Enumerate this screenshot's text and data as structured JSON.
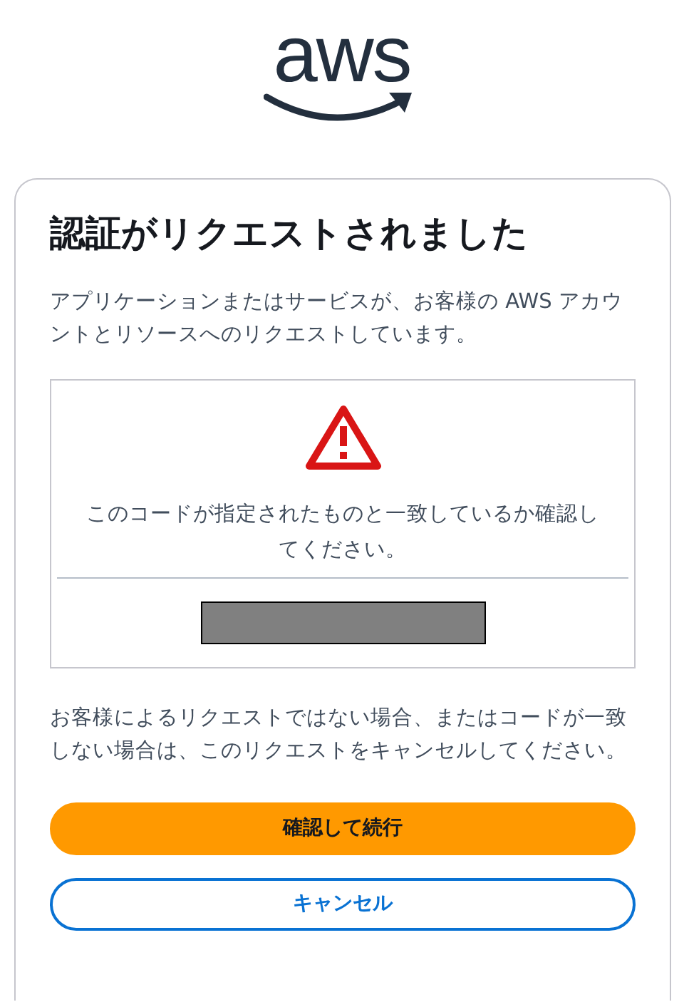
{
  "logo": {
    "text": "aws"
  },
  "card": {
    "title": "認証がリクエストされました",
    "description": "アプリケーションまたはサービスが、お客様の AWS アカウントとリソースへのリクエストしています。",
    "verification": {
      "message": "このコードが指定されたものと一致しているか確認してください。",
      "code_redacted": true
    },
    "notice": "お客様によるリクエストではない場合、またはコードが一致しない場合は、このリクエストをキャンセルしてください。",
    "buttons": [
      {
        "label": "確認して続行",
        "kind": "primary"
      },
      {
        "label": "キャンセル",
        "kind": "secondary"
      }
    ]
  }
}
